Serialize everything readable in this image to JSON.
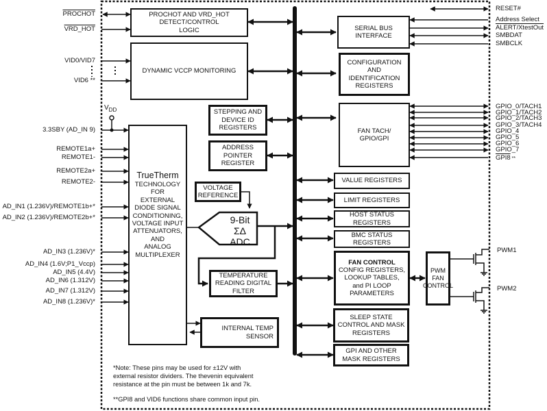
{
  "blocks": {
    "prochot_logic": [
      "PROCHOT AND VRD_HOT",
      "DETECT/CONTROL",
      "LOGIC"
    ],
    "vccp_monitoring": "DYNAMIC VCCP MONITORING",
    "serial_bus": [
      "SERIAL BUS",
      "INTERFACE"
    ],
    "config_id": [
      "CONFIGURATION",
      "AND",
      "IDENTIFICATION",
      "REGISTERS"
    ],
    "stepping": [
      "STEPPING AND",
      "DEVICE ID",
      "REGISTERS"
    ],
    "address_pointer": [
      "ADDRESS",
      "POINTER",
      "REGISTER"
    ],
    "fan_tach": [
      "FAN TACH/",
      "GPIO/GPI"
    ],
    "voltage_reference": [
      "VOLTAGE",
      "REFERENCE"
    ],
    "truetherm": {
      "title": "TrueTherm",
      "lines": [
        "TECHNOLOGY",
        "FOR",
        "EXTERNAL",
        "DIODE SIGNAL",
        "CONDITIONING,",
        "VOLTAGE INPUT",
        "ATTENUATORS,",
        "AND",
        "ANALOG",
        "MULTIPLEXER"
      ]
    },
    "adc": [
      "9-Bit",
      "ΣΔ ADC"
    ],
    "value_registers": "VALUE REGISTERS",
    "limit_registers": "LIMIT REGISTERS",
    "host_status": [
      "HOST STATUS",
      "REGISTERS"
    ],
    "bmc_status": [
      "BMC STATUS",
      "REGISTERS"
    ],
    "temp_filter": [
      "TEMPERATURE",
      "READING DIGITAL",
      "FILTER"
    ],
    "fan_control": {
      "title": "FAN CONTROL",
      "lines": [
        "CONFIG REGISTERS,",
        "LOOKUP TABLES,",
        "and PI LOOP",
        "PARAMETERS"
      ]
    },
    "pwm_fan_control": [
      "PWM",
      "FAN",
      "CONTROL"
    ],
    "internal_temp": [
      "INTERNAL TEMP",
      "SENSOR"
    ],
    "sleep_state": [
      "SLEEP STATE",
      "CONTROL AND MASK",
      "REGISTERS"
    ],
    "gpi_mask": [
      "GPI AND OTHER",
      "MASK REGISTERS"
    ]
  },
  "left_pins": {
    "prochot": "PROCHOT",
    "vrd_hot": "VRD_HOT",
    "vid0_vid7": "VID0/VID7",
    "vid6": "VID6 **",
    "vdd": "V",
    "vdd_sub": "DD",
    "sby": "3.3SBY (AD_IN 9)",
    "remote1a": "REMOTE1a+",
    "remote1m": "REMOTE1-",
    "remote2a": "REMOTE2a+",
    "remote2m": "REMOTE2-",
    "ad_in1": "AD_IN1 (1.236V)/REMOTE1b+*",
    "ad_in2": "AD_IN2 (1.236V)/REMOTE2b+*",
    "ad_in3": "AD_IN3 (1.236V)*",
    "ad_in4": "AD_IN4 (1.6V;P1_Vccp)",
    "ad_in5": "AD_IN5 (4.4V)",
    "ad_in6": "AD_IN6 (1.312V)",
    "ad_in7": "AD_IN7 (1.312V)",
    "ad_in8": "AD_IN8 (1.236V)*"
  },
  "right_pins": {
    "reset": "RESET#",
    "address_select": "Address Select",
    "alert": "ALERT/XtestOut",
    "smbdat": "SMBDAT",
    "smbclk": "SMBCLK",
    "gpio": [
      "GPIO_0/TACH1",
      "GPIO_1/TACH2",
      "GPIO_2/TACH3",
      "GPIO_3/TACH4",
      "GPIO_4",
      "GPIO_5",
      "GPIO_6",
      "GPIO_7"
    ],
    "gpi8": "GPI8",
    "gpi8_suffix": " **",
    "pwm1": "PWM1",
    "pwm2": "PWM2"
  },
  "notes": {
    "note1": [
      "*Note: These pins may be used for ±12V with",
      "external  resistor dividers. The thevenin equivalent",
      "resistance at the pin must be between 1k and 7k."
    ],
    "note2": "**GPI8 and VID6 functions share common input pin."
  }
}
